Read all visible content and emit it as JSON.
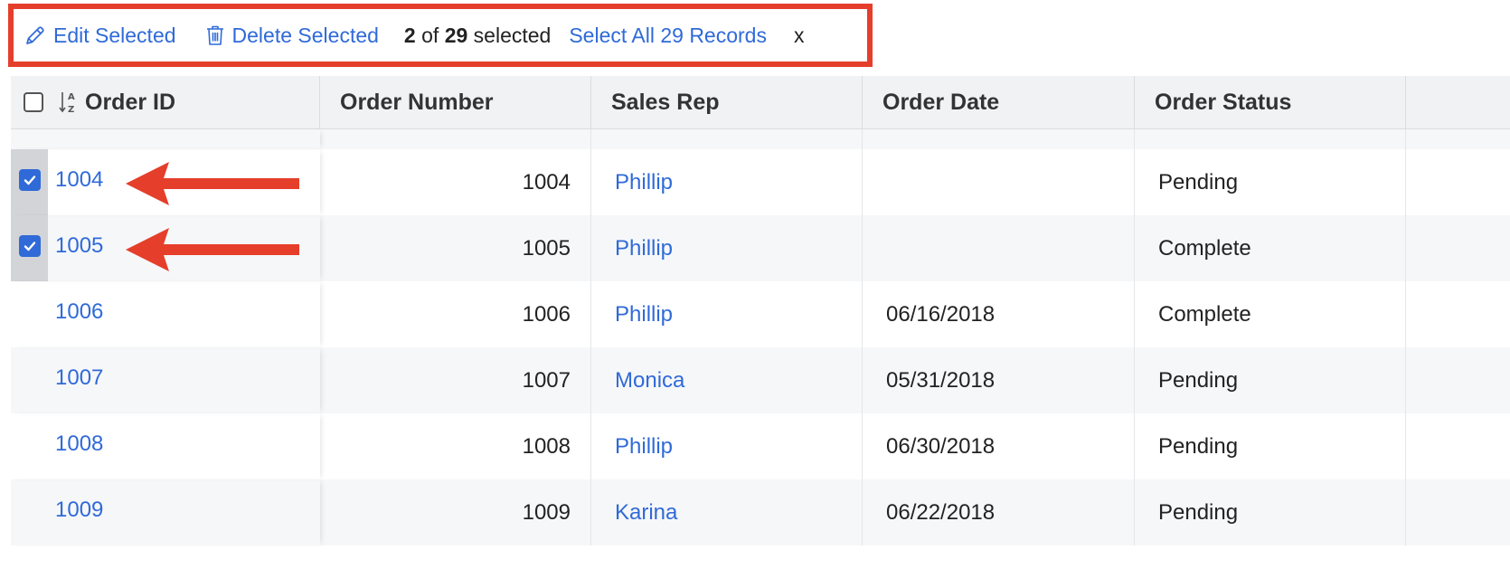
{
  "action_bar": {
    "edit_label": "Edit Selected",
    "delete_label": "Delete Selected",
    "selected_count": "2",
    "of_text": "of",
    "total_count": "29",
    "selected_text": "selected",
    "select_all_label": "Select All 29 Records",
    "close_label": "x",
    "highlight_color": "#e53e2b"
  },
  "columns": {
    "order_id": "Order ID",
    "order_number": "Order Number",
    "sales_rep": "Sales Rep",
    "order_date": "Order Date",
    "order_status": "Order Status"
  },
  "rows": [
    {
      "id": "1004",
      "number": "1004",
      "rep": "Phillip",
      "date": "",
      "status": "Pending",
      "selected": true
    },
    {
      "id": "1005",
      "number": "1005",
      "rep": "Phillip",
      "date": "",
      "status": "Complete",
      "selected": true
    },
    {
      "id": "1006",
      "number": "1006",
      "rep": "Phillip",
      "date": "06/16/2018",
      "status": "Complete",
      "selected": false
    },
    {
      "id": "1007",
      "number": "1007",
      "rep": "Monica",
      "date": "05/31/2018",
      "status": "Pending",
      "selected": false
    },
    {
      "id": "1008",
      "number": "1008",
      "rep": "Phillip",
      "date": "06/30/2018",
      "status": "Pending",
      "selected": false
    },
    {
      "id": "1009",
      "number": "1009",
      "rep": "Karina",
      "date": "06/22/2018",
      "status": "Pending",
      "selected": false
    }
  ],
  "icons": {
    "edit": "pencil-icon",
    "delete": "trash-icon",
    "sort": "sort-az-icon",
    "checked": "checkmark-icon",
    "annotation": "arrow-left-icon"
  },
  "colors": {
    "link": "#2f6ad8",
    "annotation": "#e53e2b",
    "checkbox": "#2f6ad8"
  }
}
